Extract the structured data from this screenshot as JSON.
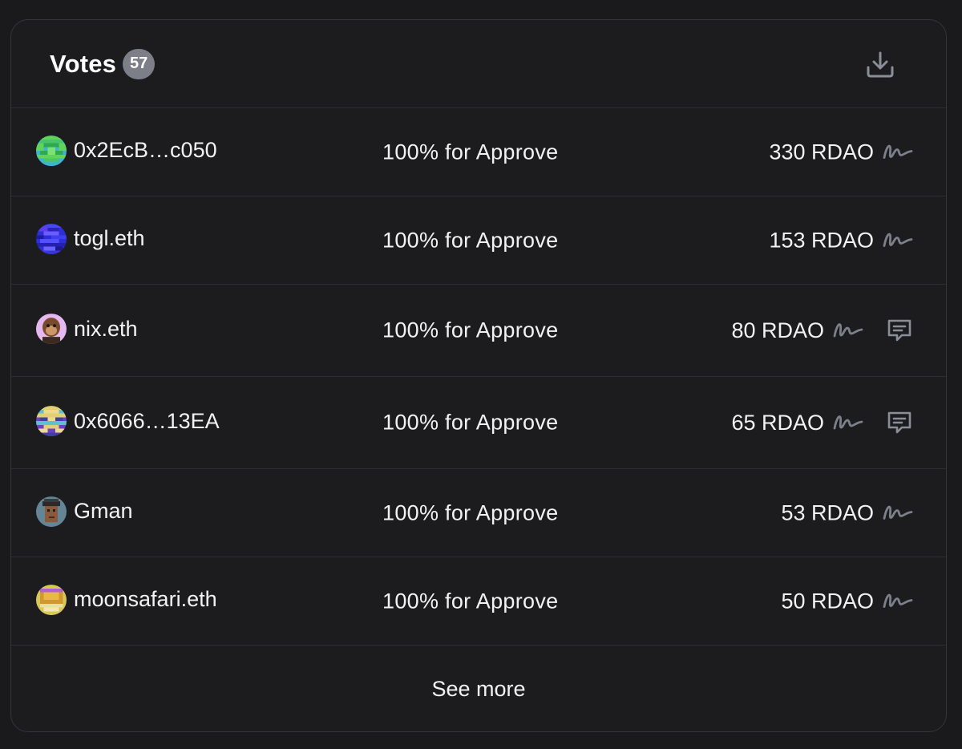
{
  "header": {
    "title": "Votes",
    "count": "57",
    "download_icon": "download-icon"
  },
  "votes": [
    {
      "voter": "0x2EcB…c050",
      "choice": "100% for Approve",
      "power": "330 RDAO",
      "has_comment": false,
      "avatar": "green-pixel-avatar"
    },
    {
      "voter": "togl.eth",
      "choice": "100% for Approve",
      "power": "153 RDAO",
      "has_comment": false,
      "avatar": "blue-pixel-avatar"
    },
    {
      "voter": "nix.eth",
      "choice": "100% for Approve",
      "power": "80 RDAO",
      "has_comment": true,
      "avatar": "ape-avatar"
    },
    {
      "voter": "0x6066…13EA",
      "choice": "100% for Approve",
      "power": "65 RDAO",
      "has_comment": true,
      "avatar": "colorful-pixel-avatar"
    },
    {
      "voter": "Gman",
      "choice": "100% for Approve",
      "power": "53 RDAO",
      "has_comment": false,
      "avatar": "punk-avatar"
    },
    {
      "voter": "moonsafari.eth",
      "choice": "100% for Approve",
      "power": "50 RDAO",
      "has_comment": false,
      "avatar": "yellow-pixel-avatar"
    }
  ],
  "footer": {
    "see_more_label": "See more"
  },
  "colors": {
    "background": "#1a1a1c",
    "card": "#1c1c1e",
    "border": "#35353a",
    "badge": "#7c7f88",
    "icon_gray": "#8b8e99"
  }
}
